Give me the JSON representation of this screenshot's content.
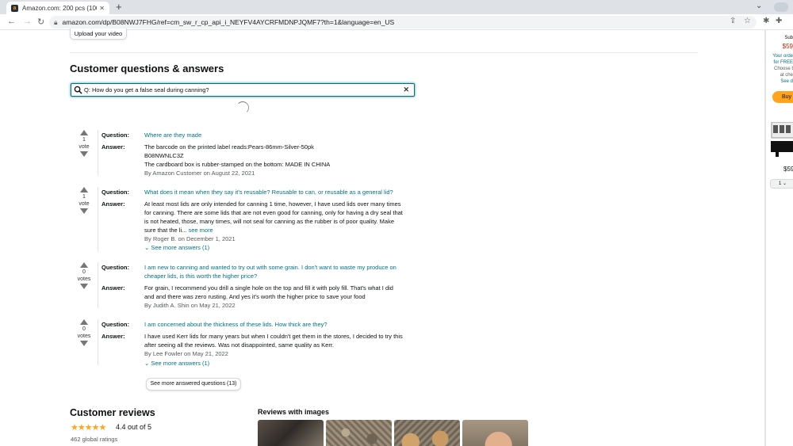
{
  "browser": {
    "tab_title": "Amazon.com: 200 pcs (100 pcs ...",
    "new_tab": "+",
    "url": "amazon.com/dp/B08NWJ7FHG/ref=cm_sw_r_cp_api_i_NEYFV4AYCRFMDNPJQMF7?th=1&language=en_US"
  },
  "page": {
    "upload_video": "Upload your video",
    "qa_title": "Customer questions & answers",
    "search_value": "Q: How do you get a false seal during canning?",
    "question_label": "Question:",
    "answer_label": "Answer:",
    "qa": [
      {
        "votes": "1",
        "votes_word": "vote",
        "question": "Where are they made",
        "answer_lines": [
          "The barcode on the printed label reads:Pears-86mm-Silver-50pk",
          "B08NWNLC3Z",
          "The cardboard box is rubber-stamped on the bottom: MADE IN CHINA"
        ],
        "byline": "By Amazon Customer on August 22, 2021"
      },
      {
        "votes": "1",
        "votes_word": "vote",
        "question": "What does it mean when they say it's reusable? Reusable to can, or reusable as a general lid?",
        "answer_lines": [
          "At least most lids are only intended for canning 1 time, however, I have used lids over many times",
          "for canning. There are some lids that are not even good for canning, only for having a dry seal that",
          "is not heated, those, many times, will not seal for canning as the rubber is of poor quality. Make",
          "sure that the li..."
        ],
        "answer_more": "see more",
        "byline": "By Roger B. on December 1, 2021",
        "see_more_answers": "⌄ See more answers (1)"
      },
      {
        "votes": "0",
        "votes_word": "votes",
        "question": "I am new to canning and wanted to try out with some grain. I don't want to waste my produce on cheaper lids, is this worth the higher price?",
        "answer_lines": [
          "For grain, I recommend you drill a single hole on the top and fill it with poly fill. That's what I did",
          "and and there was zero rusting. And yes it's worth the higher price to save your food"
        ],
        "byline": "By Judith A. Shin on May 21, 2022"
      },
      {
        "votes": "0",
        "votes_word": "votes",
        "question": "I am concerned about the thickness of these lids. How thick are they?",
        "answer_lines": [
          "I have used Kerr lids for many years but when I couldn't get them in the stores, I decided to try this",
          "after seeing all the reviews. Was not disappointed, same quality as Kerr."
        ],
        "byline": "By Lee Fowler on May 21, 2022",
        "see_more_answers": "⌄ See more answers (1)"
      }
    ],
    "see_answered": "See more answered questions (13)",
    "reviews": {
      "title": "Customer reviews",
      "stars": "★★★★★",
      "rating_text": "4.4 out of 5",
      "global_ratings": "462 global ratings",
      "images_title": "Reviews with images"
    }
  },
  "buybox": {
    "sub": "Sub",
    "price": "$59",
    "order_lines": [
      "Your orde",
      "for FREE",
      "Choose t",
      "at che",
      "See d"
    ],
    "buy": "Buy",
    "price2": "$59",
    "qty": "1"
  },
  "colors": {
    "link": "#007185",
    "star": "#ffa41c",
    "price_red": "#b12704",
    "buy_button": "#ffa41c"
  }
}
